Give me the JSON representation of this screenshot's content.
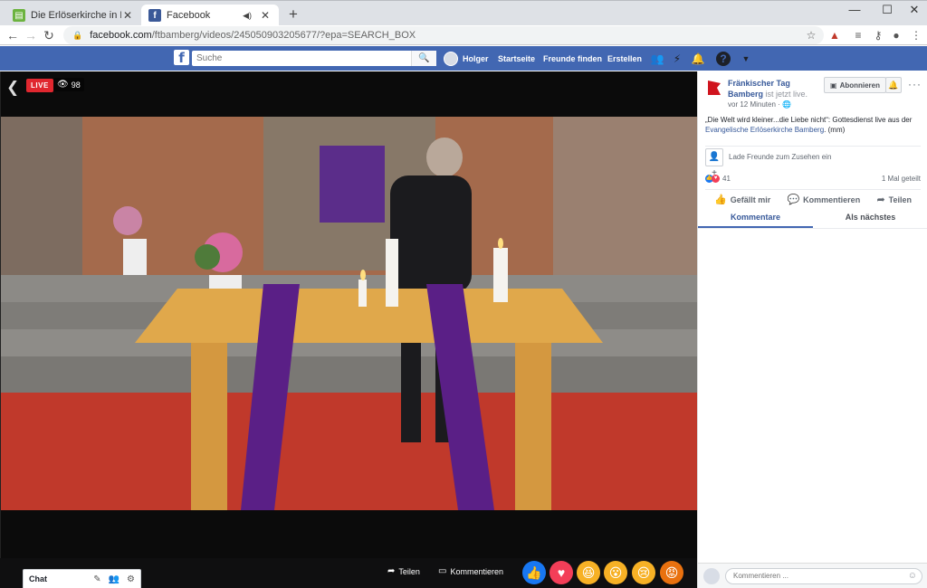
{
  "browser": {
    "tabs": [
      {
        "title": "Die Erlöserkirche in Bamberg ist l",
        "icon": "document-icon"
      },
      {
        "title": "Facebook",
        "icon": "facebook-icon"
      }
    ],
    "url_host": "facebook.com",
    "url_path": "/ftbamberg/videos/245050903205677/?epa=SEARCH_BOX"
  },
  "fb": {
    "logo": "f",
    "search_placeholder": "Suche",
    "user": "Holger",
    "nav": [
      "Startseite",
      "Freunde finden",
      "Erstellen"
    ]
  },
  "video": {
    "live_label": "LIVE",
    "viewers": "98",
    "share_label": "Teilen",
    "comment_label": "Kommentieren"
  },
  "chat": {
    "label": "Chat"
  },
  "panel": {
    "page_name": "Fränkischer Tag Bamberg",
    "status": "ist jetzt live.",
    "time_ago": "vor 12 Minuten ·",
    "subscribe_label": "Abonnieren",
    "description_pre": "„Die Welt wird kleiner...die Liebe nicht“: Gottesdienst live aus der",
    "description_link": "Evangelische Erlöserkirche Bamberg",
    "description_post": ". (mm)",
    "invite_text": "Lade Freunde zum Zusehen ein",
    "reaction_count": "41",
    "shares": "1 Mal geteilt",
    "actions": [
      "Gefällt mir",
      "Kommentieren",
      "Teilen"
    ],
    "tabs": [
      "Kommentare",
      "Als nächstes"
    ],
    "comment_placeholder": "Kommentieren ..."
  },
  "colors": {
    "fb_blue": "#4267b2",
    "live_red": "#e0272f",
    "link_blue": "#365899"
  }
}
